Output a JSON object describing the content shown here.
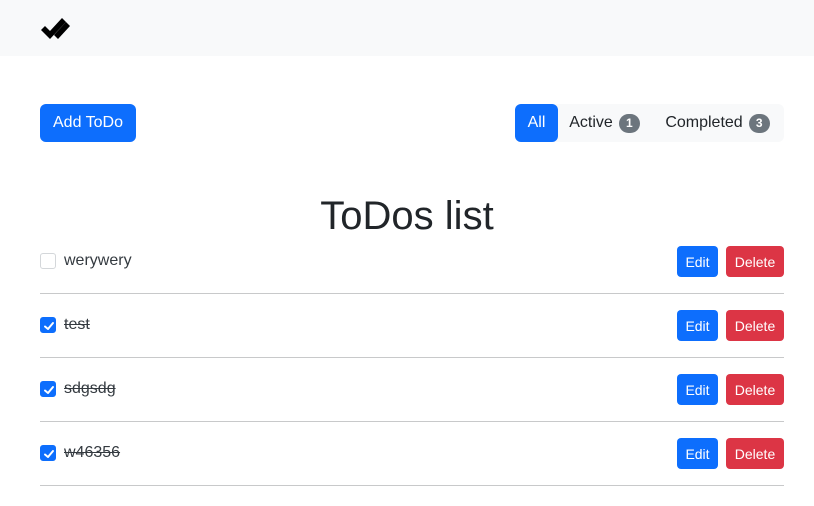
{
  "navbar": {
    "logo_icon": "double-check-icon"
  },
  "toolbar": {
    "add_label": "Add ToDo"
  },
  "filters": [
    {
      "label": "All",
      "active": true
    },
    {
      "label": "Active",
      "count": "1",
      "active": false
    },
    {
      "label": "Completed",
      "count": "3",
      "active": false
    }
  ],
  "title": "ToDos list",
  "todos": [
    {
      "text": "werywery",
      "completed": false,
      "edit_label": "Edit",
      "delete_label": "Delete"
    },
    {
      "text": "test",
      "completed": true,
      "edit_label": "Edit",
      "delete_label": "Delete"
    },
    {
      "text": "sdgsdg",
      "completed": true,
      "edit_label": "Edit",
      "delete_label": "Delete"
    },
    {
      "text": "w46356",
      "completed": true,
      "edit_label": "Edit",
      "delete_label": "Delete"
    }
  ],
  "colors": {
    "primary": "#0d6efd",
    "danger": "#dc3545",
    "badge": "#6c757d",
    "navbar_bg": "#f8f9fa"
  }
}
